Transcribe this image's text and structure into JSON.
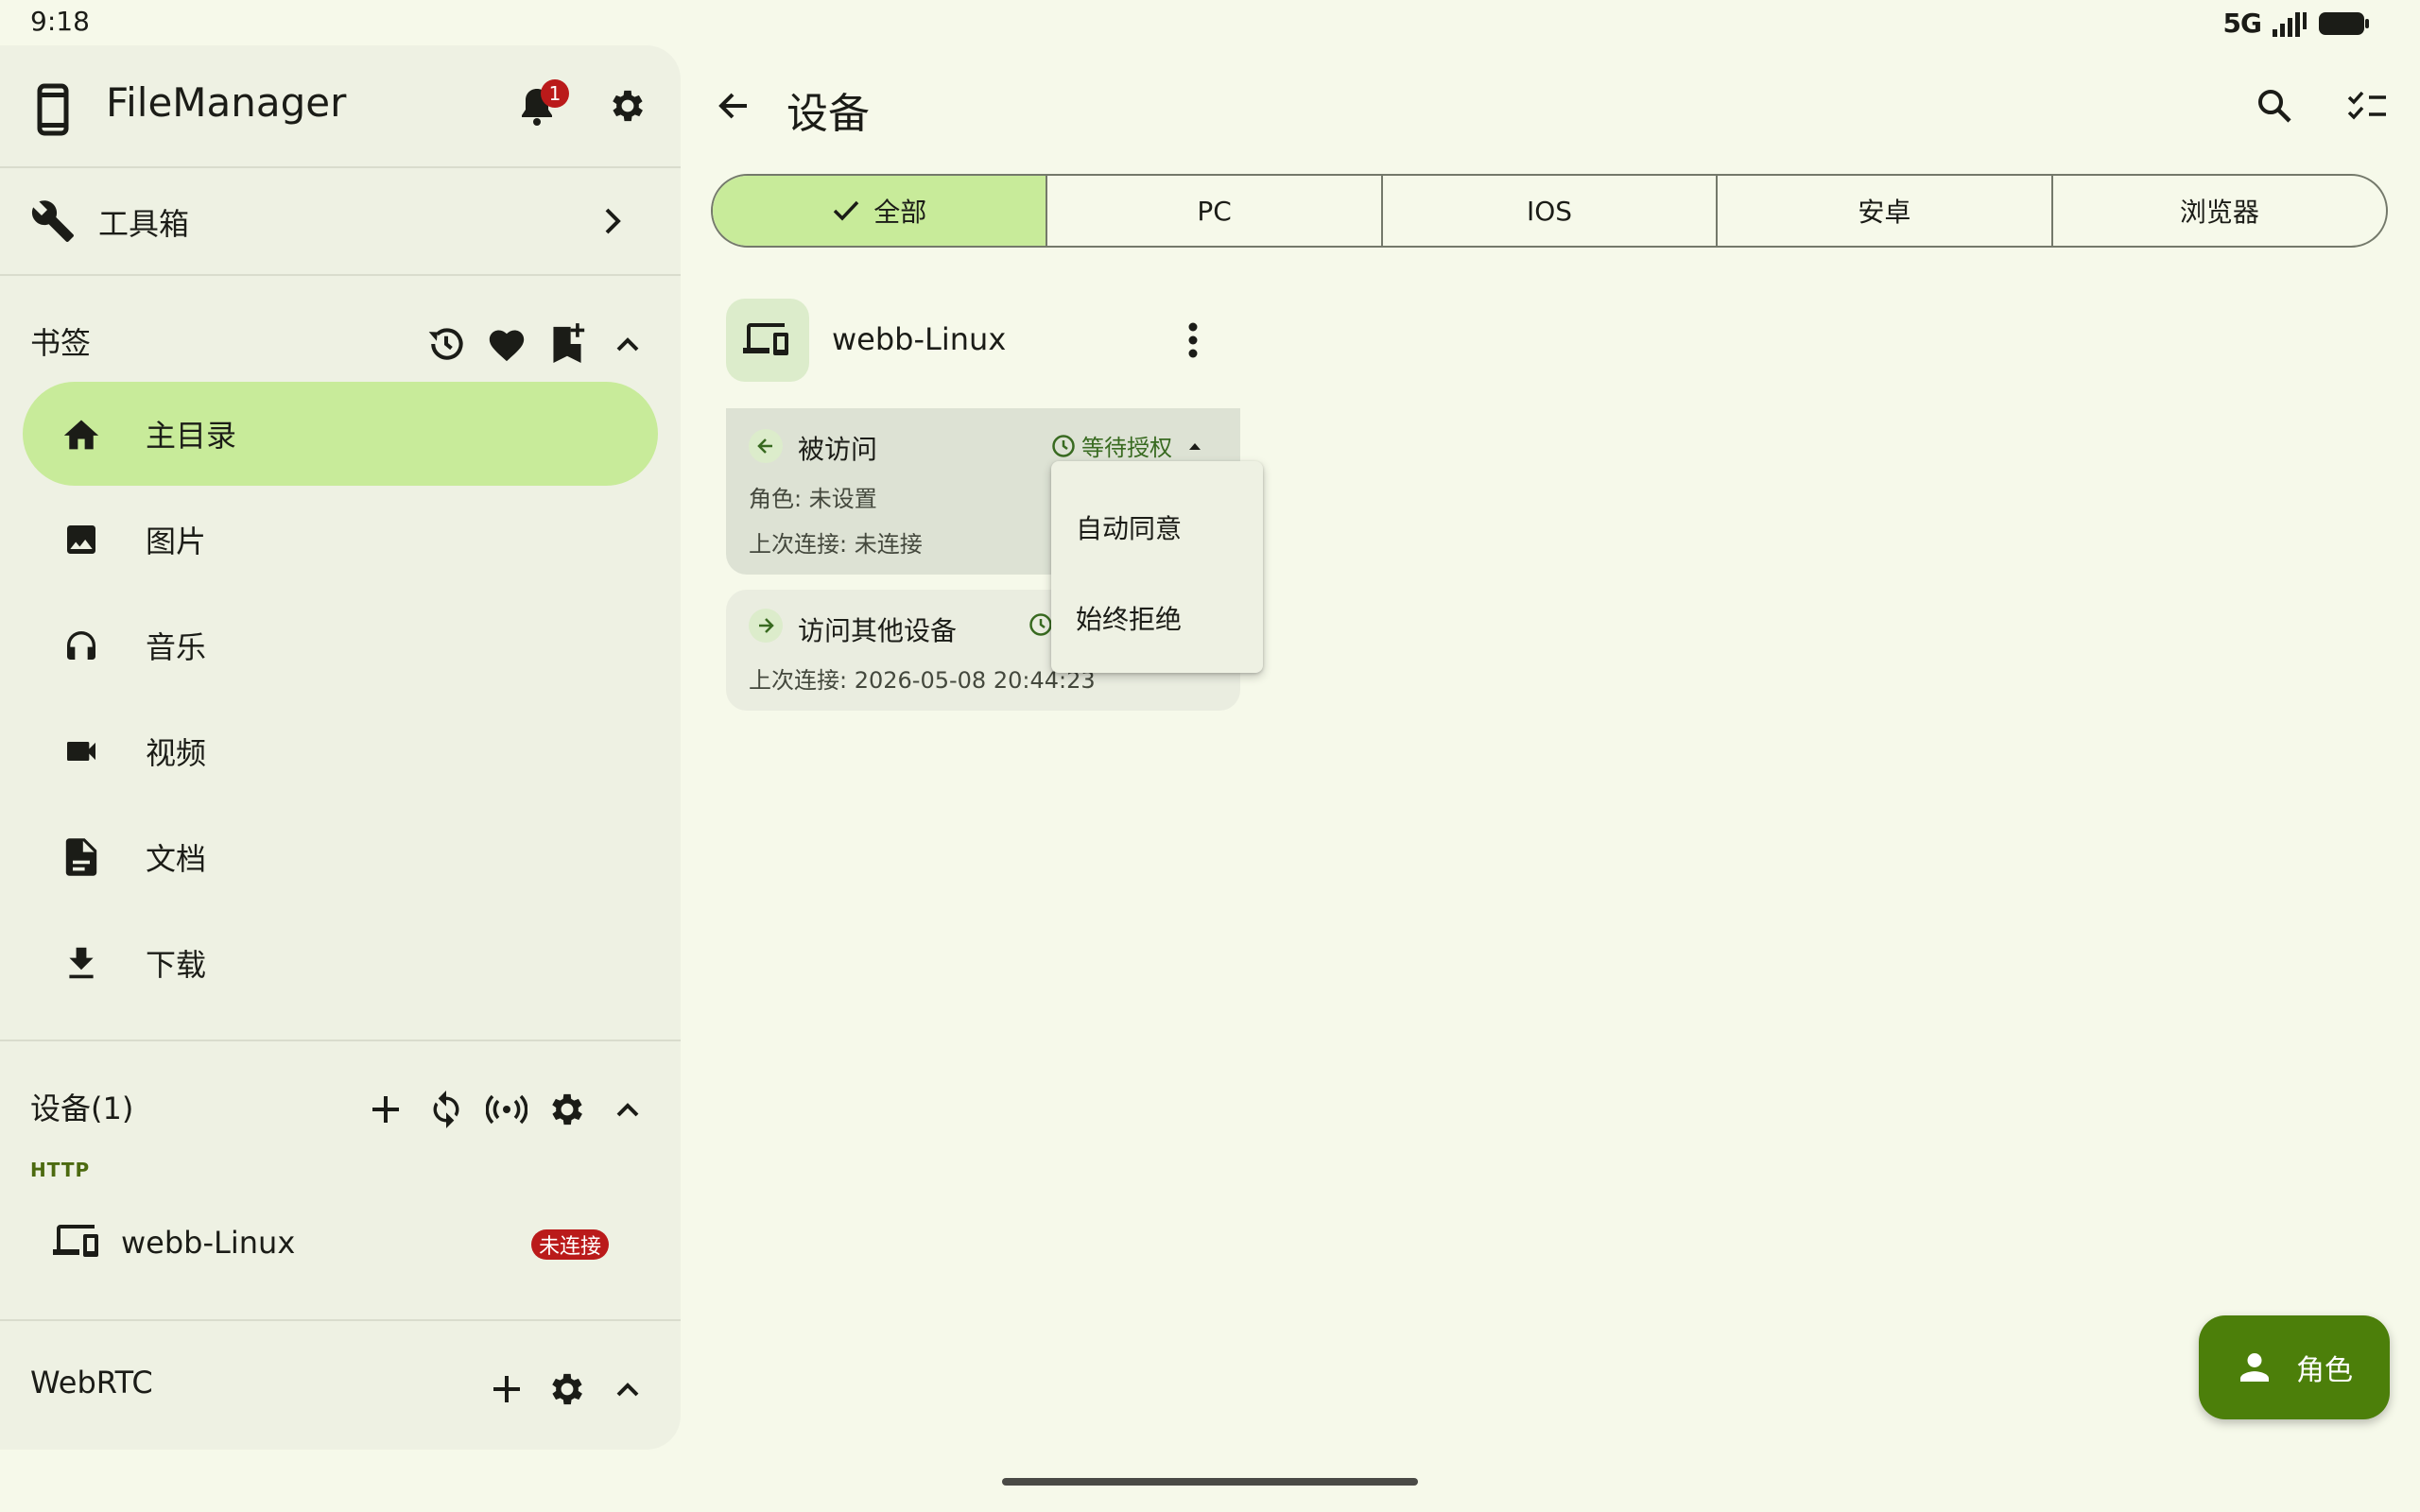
{
  "status": {
    "time": "9:18",
    "network": "5G"
  },
  "sidebar": {
    "app_title": "FileManager",
    "notification_count": "1",
    "toolbox_label": "工具箱",
    "bookmarks": {
      "title": "书签",
      "items": [
        {
          "label": "主目录",
          "icon": "home-icon",
          "active": true
        },
        {
          "label": "图片",
          "icon": "image-icon"
        },
        {
          "label": "音乐",
          "icon": "headphones-icon"
        },
        {
          "label": "视频",
          "icon": "videocam-icon"
        },
        {
          "label": "文档",
          "icon": "document-icon"
        },
        {
          "label": "下载",
          "icon": "download-icon"
        }
      ]
    },
    "devices": {
      "title": "设备(1)",
      "group_label": "HTTP",
      "device_name": "webb-Linux",
      "device_status": "未连接"
    },
    "webrtc": {
      "title": "WebRTC"
    }
  },
  "main": {
    "title": "设备",
    "tabs": [
      "全部",
      "PC",
      "IOS",
      "安卓",
      "浏览器"
    ],
    "device": {
      "name": "webb-Linux",
      "accessed": {
        "title": "被访问",
        "status": "等待授权",
        "role_line": "角色: 未设置",
        "last_connect_line": "上次连接: 未连接"
      },
      "access_others": {
        "title": "访问其他设备",
        "last_connect_line": "上次连接: 2026-05-08 20:44:23"
      }
    },
    "menu": {
      "items": [
        "自动同意",
        "始终拒绝"
      ]
    },
    "fab_label": "角色"
  },
  "colors": {
    "accent": "#4c7f0a",
    "selected": "#c8eb9a",
    "error": "#ba1a1a",
    "background": "#f6f9ea"
  }
}
